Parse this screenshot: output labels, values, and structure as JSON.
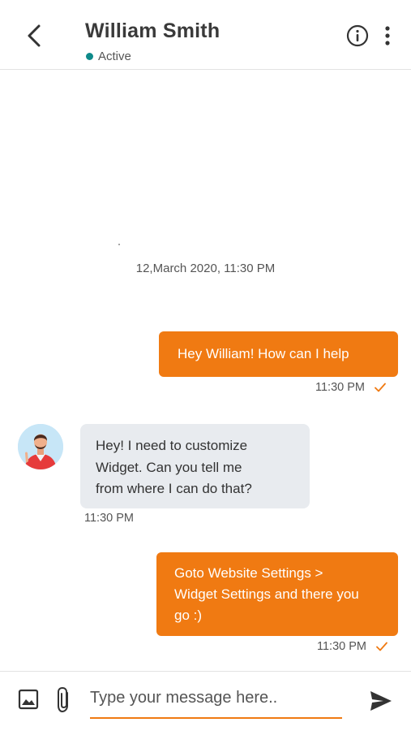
{
  "header": {
    "contact_name": "William Smith",
    "status_text": "Active",
    "status_color": "#0e8a8a"
  },
  "icons": {
    "back": "chevron-left-icon",
    "info": "info-circle-icon",
    "more": "more-vertical-icon",
    "image": "image-icon",
    "attach": "paperclip-icon",
    "send": "send-icon",
    "read": "check-icon"
  },
  "conversation": {
    "date_separator": "12,March 2020, 11:30 PM",
    "messages": [
      {
        "direction": "outgoing",
        "lines": [
          "Hey William! How can I help"
        ],
        "time": "11:30 PM",
        "read": true
      },
      {
        "direction": "incoming",
        "lines": [
          "Hey! I need to customize",
          "Widget. Can you tell me",
          "from where I can do that?"
        ],
        "time": "11:30 PM"
      },
      {
        "direction": "outgoing",
        "lines": [
          "Goto Website Settings >",
          "Widget Settings and there you",
          "go :)"
        ],
        "time": "11:30 PM",
        "read": true
      }
    ]
  },
  "composer": {
    "placeholder": "Type your message here..",
    "value": ""
  },
  "colors": {
    "accent": "#f07a12",
    "incoming_bubble": "#e8ebef",
    "status_dot": "#0e8a8a"
  }
}
